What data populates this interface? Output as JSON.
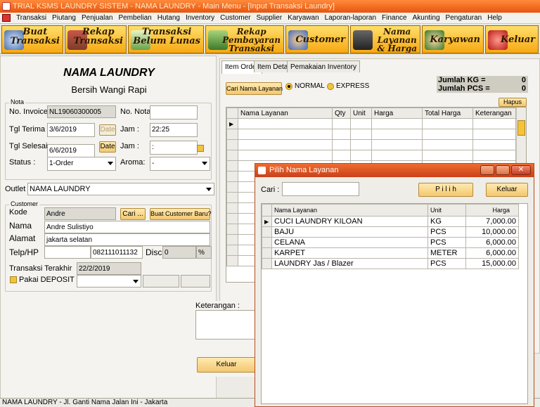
{
  "window": {
    "title": "TRIAL KSMS LAUNDRY SISTEM - NAMA LAUNDRY - Main Menu - [Input Transaksi Laundry]"
  },
  "menu": [
    "Transaksi",
    "Piutang",
    "Penjualan",
    "Pembelian",
    "Hutang",
    "Inventory",
    "Customer",
    "Supplier",
    "Karyawan",
    "Laporan-laporan",
    "Finance",
    "Akunting",
    "Pengaturan",
    "Help"
  ],
  "toolbar": [
    {
      "label": "Buat\nTransaksi",
      "icon": "cash-register-icon"
    },
    {
      "label": "Rekap\nTransaksi",
      "icon": "books-icon"
    },
    {
      "label": "Transaksi\nBelum Lunas",
      "icon": "calculator-icon"
    },
    {
      "label": "Rekap\nPembayaran\nTransaksi",
      "icon": "payment-icon"
    },
    {
      "label": "Customer",
      "icon": "users-icon"
    },
    {
      "label": "Nama\nLayanan\n& Harga",
      "icon": "shirt-icon"
    },
    {
      "label": "Karyawan",
      "icon": "employee-icon"
    },
    {
      "label": "Keluar",
      "icon": "exit-icon"
    }
  ],
  "header": {
    "title": "NAMA LAUNDRY",
    "subtitle": "Bersih Wangi Rapi"
  },
  "nota": {
    "group": "Nota",
    "invoice_label": "No. Invoice:",
    "invoice_value": "NL19060300005",
    "nonota_label": "No. Nota",
    "nonota_value": "",
    "tglterima_label": "Tgl Terima",
    "tglterima_value": "3/6/2019",
    "date_btn": "Date",
    "jam1_label": "Jam :",
    "jam1_value": "22:25",
    "tglselesai_label": "Tgl Selesai",
    "tglselesai_value": "6/6/2019",
    "jam2_label": "Jam :",
    "jam2_value": " :",
    "status_label": "Status :",
    "status_value": "1-Order",
    "aroma_label": "Aroma:",
    "aroma_value": "-"
  },
  "outlet": {
    "label": "Outlet :",
    "value": "NAMA LAUNDRY"
  },
  "customer": {
    "group": "Customer",
    "kode_label": "Kode",
    "kode_value": "Andre",
    "cari_btn": "Cari ...",
    "baru_btn": "Buat Customer Baru?",
    "nama_label": "Nama",
    "nama_value": "Andre Sulistiyo",
    "alamat_label": "Alamat",
    "alamat_value": "jakarta selatan",
    "telp_label": "Telp/HP",
    "telp1_value": "",
    "telp2_value": "082111011132",
    "disc_label": "Disc",
    "disc_value": "0",
    "disc_unit": "%",
    "terakhir_label": "Transaksi Terakhir",
    "terakhir_value": "22/2/2019",
    "deposit_label": "Pakai DEPOSIT ?"
  },
  "tabs": [
    "Item Order",
    "Item Detail",
    "Pemakaian Inventory"
  ],
  "order": {
    "cari_btn": "Cari Nama Layanan",
    "normal": "NORMAL",
    "express": "EXPRESS",
    "kg_label": "Jumlah KG =",
    "kg_value": "0",
    "pcs_label": "Jumlah PCS =",
    "pcs_value": "0",
    "hapus_btn": "Hapus",
    "columns": [
      "Nama Layanan",
      "Qty",
      "Unit",
      "Harga",
      "Total Harga",
      "Keterangan"
    ]
  },
  "keterangan": {
    "label": "Keterangan :"
  },
  "keluar_btn": "Keluar",
  "status_bar": "NAMA LAUNDRY - Jl. Ganti Nama Jalan Ini - Jakarta",
  "dialog": {
    "title": "Pilih Nama Layanan",
    "cari_label": "Cari :",
    "cari_value": "",
    "pilih_btn": "P i l i h",
    "keluar_btn": "Keluar",
    "columns": [
      "Nama Layanan",
      "Unit",
      "Harga"
    ],
    "rows": [
      [
        "CUCI LAUNDRY KILOAN",
        "KG",
        "7,000.00"
      ],
      [
        "BAJU",
        "PCS",
        "10,000.00"
      ],
      [
        "CELANA",
        "PCS",
        "6,000.00"
      ],
      [
        "KARPET",
        "METER",
        "6,000.00"
      ],
      [
        "LAUNDRY Jas / Blazer",
        "PCS",
        "15,000.00"
      ]
    ]
  },
  "colors": {
    "accent": "#f7a812",
    "title": "#e8540c"
  }
}
